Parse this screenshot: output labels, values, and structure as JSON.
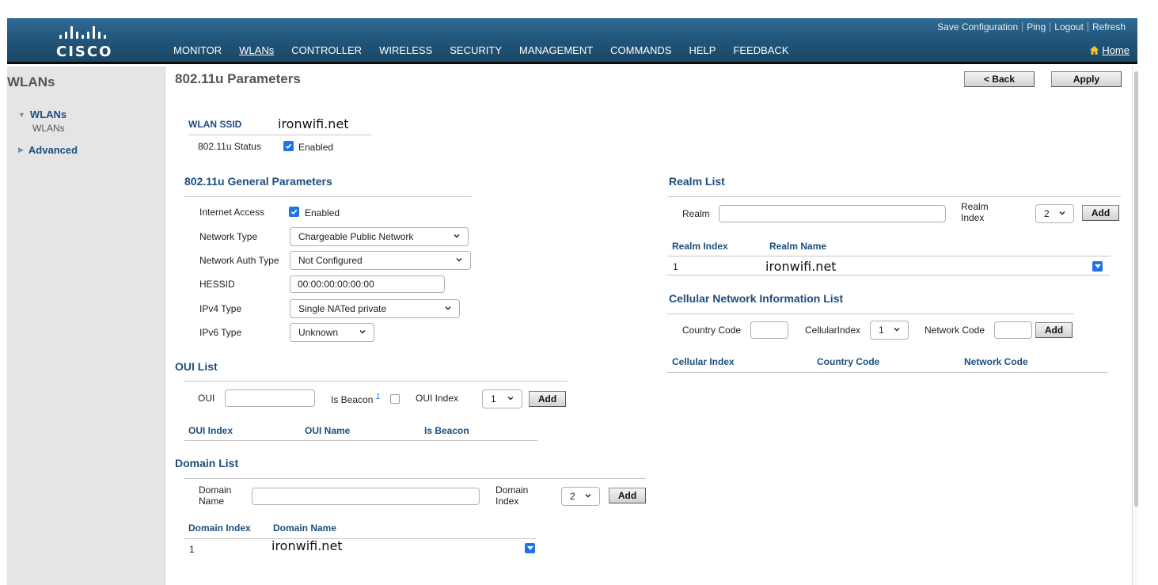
{
  "header": {
    "logo_text": "CISCO",
    "utility_links": [
      "Save Configuration",
      "Ping",
      "Logout",
      "Refresh"
    ],
    "nav_items": [
      "MONITOR",
      "WLANs",
      "CONTROLLER",
      "WIRELESS",
      "SECURITY",
      "MANAGEMENT",
      "COMMANDS",
      "HELP",
      "FEEDBACK"
    ],
    "active_nav": "WLANs",
    "home_label": "Home"
  },
  "sidebar": {
    "title": "WLANs",
    "items": [
      {
        "label": "WLANs",
        "expanded": true
      },
      {
        "label": "WLANs"
      },
      {
        "label": "Advanced",
        "expanded": false
      }
    ]
  },
  "page": {
    "title": "802.11u Parameters",
    "back_label": "< Back",
    "apply_label": "Apply"
  },
  "wlan": {
    "ssid_label": "WLAN SSID",
    "ssid_value": "ironwifi.net",
    "status_label": "802.11u Status",
    "status_checked": true,
    "status_text": "Enabled"
  },
  "general": {
    "heading": "802.11u General Parameters",
    "internet_access_label": "Internet Access",
    "internet_access_checked": true,
    "internet_access_text": "Enabled",
    "network_type_label": "Network Type",
    "network_type_value": "Chargeable Public Network",
    "network_auth_label": "Network Auth Type",
    "network_auth_value": "Not Configured",
    "hessid_label": "HESSID",
    "hessid_value": "00:00:00:00:00:00",
    "ipv4_label": "IPv4 Type",
    "ipv4_value": "Single NATed private",
    "ipv6_label": "IPv6 Type",
    "ipv6_value": "Unknown"
  },
  "oui": {
    "heading": "OUI List",
    "oui_label": "OUI",
    "oui_value": "",
    "is_beacon_label": "Is Beacon",
    "is_beacon_footnote": "1",
    "is_beacon_checked": false,
    "index_label": "OUI Index",
    "index_value": "1",
    "add_label": "Add",
    "columns": [
      "OUI Index",
      "OUI Name",
      "Is Beacon"
    ]
  },
  "domain": {
    "heading": "Domain List",
    "name_label": "Domain Name",
    "name_value": "",
    "index_label": "Domain Index",
    "index_value": "2",
    "add_label": "Add",
    "columns": [
      "Domain Index",
      "Domain Name"
    ],
    "rows": [
      {
        "index": "1",
        "name": "ironwifi.net"
      }
    ]
  },
  "realm": {
    "heading": "Realm List",
    "realm_label": "Realm",
    "realm_value": "",
    "index_label": "Realm Index",
    "index_value": "2",
    "add_label": "Add",
    "columns": [
      "Realm Index",
      "Realm Name"
    ],
    "rows": [
      {
        "index": "1",
        "name": "ironwifi.net"
      }
    ]
  },
  "cellular": {
    "heading": "Cellular Network Information List",
    "country_code_label": "Country Code",
    "country_code_value": "",
    "cellular_index_label": "CellularIndex",
    "cellular_index_value": "1",
    "network_code_label": "Network Code",
    "network_code_value": "",
    "add_label": "Add",
    "columns": [
      "Cellular Index",
      "Country Code",
      "Network Code"
    ]
  },
  "colors": {
    "header_blue": "#215478",
    "heading_blue": "#1d4e7c",
    "checkbox_blue": "#1e73e8",
    "sidebar_gray": "#e5e5e5",
    "home_icon": "#f5c22b"
  },
  "icons": [
    "cisco-logo-icon",
    "home-icon",
    "chevron-down-icon",
    "checkbox-check-icon",
    "tree-expand-icon",
    "tree-collapse-icon"
  ]
}
